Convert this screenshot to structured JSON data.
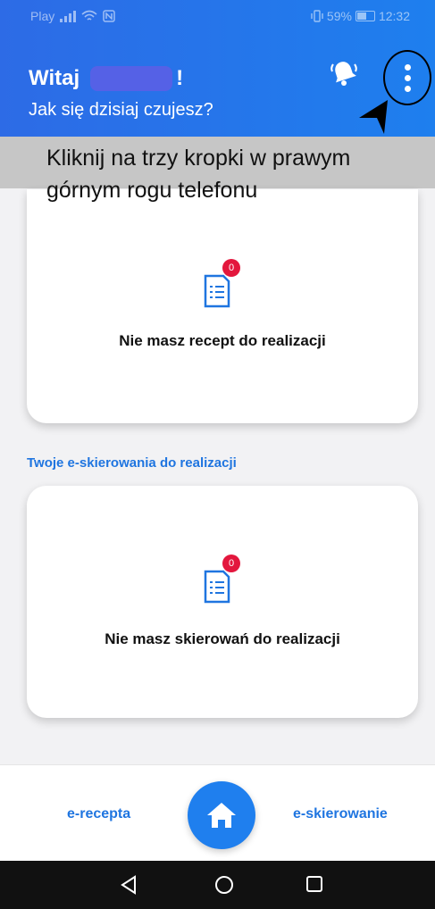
{
  "status_bar": {
    "carrier": "Play",
    "battery_percent": "59%",
    "time": "12:32"
  },
  "header": {
    "greeting_prefix": "Witaj",
    "greeting_suffix": "!",
    "subtitle": "Jak się dzisiaj czujesz?"
  },
  "instruction": {
    "text": "Kliknij na trzy kropki w prawym górnym rogu telefonu"
  },
  "prescriptions_card": {
    "badge_count": "0",
    "message": "Nie masz recept do realizacji"
  },
  "referrals_section": {
    "title": "Twoje e-skierowania do realizacji"
  },
  "referrals_card": {
    "badge_count": "0",
    "message": "Nie masz skierowań do realizacji"
  },
  "bottom_nav": {
    "left_label": "e-recepta",
    "right_label": "e-skierowanie"
  },
  "colors": {
    "header": "#2d6be6",
    "accent": "#1f75e0",
    "badge": "#e3173d"
  },
  "icons": [
    "bell-icon",
    "more-vertical-icon",
    "document-list-icon",
    "home-icon",
    "back-icon",
    "circle-home-icon",
    "recents-icon"
  ]
}
